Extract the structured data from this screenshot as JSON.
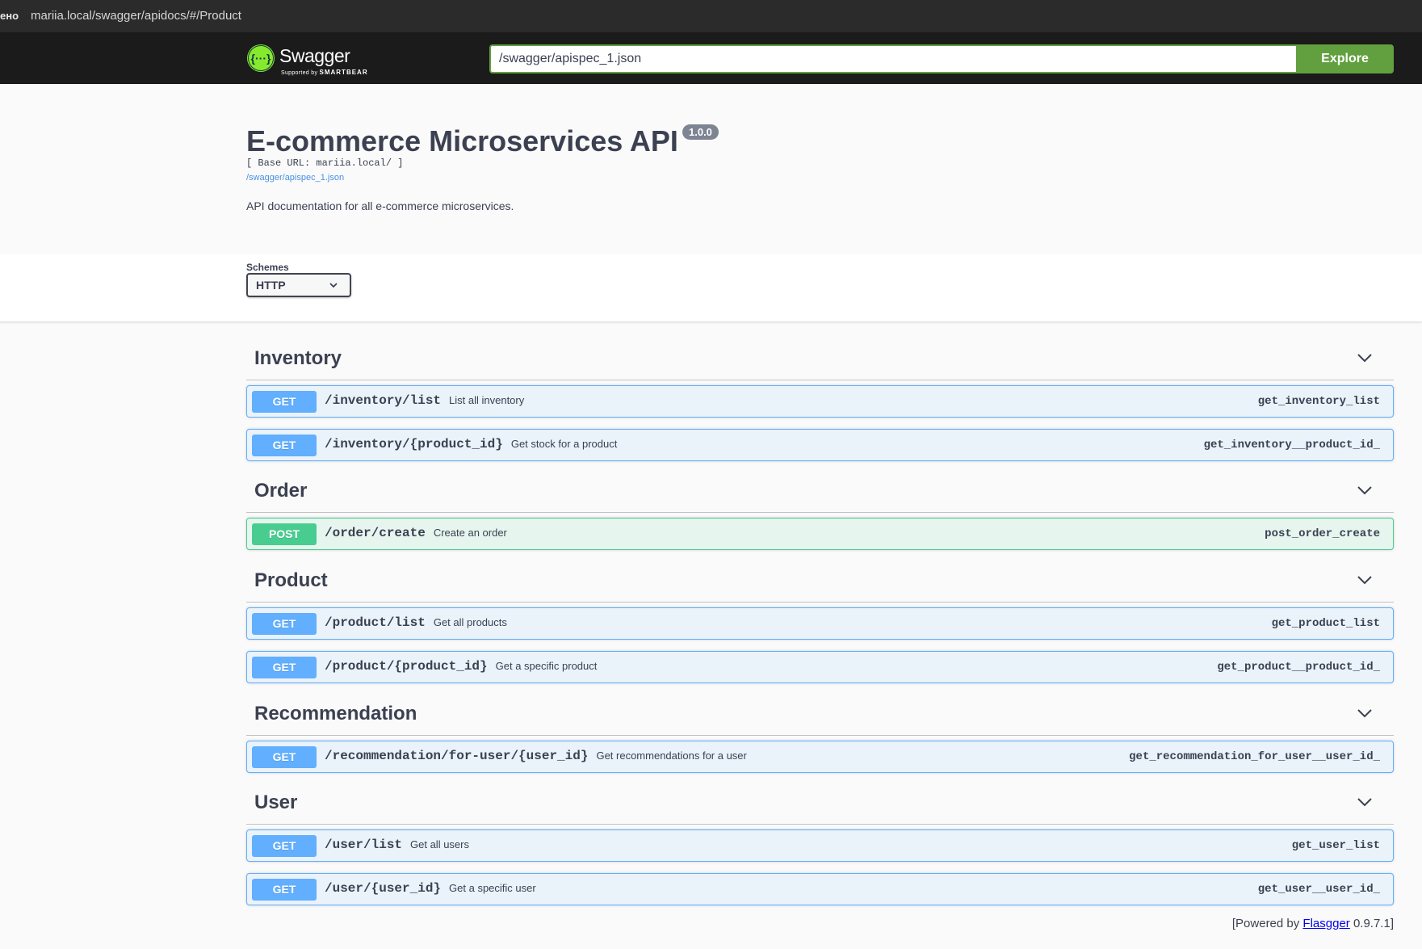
{
  "browser": {
    "security_label": "ено",
    "url": "mariia.local/swagger/apidocs/#/Product"
  },
  "topbar": {
    "logo_text": "Swagger",
    "logo_sub_prefix": "Supported by",
    "logo_sub_brand": "SMARTBEAR",
    "spec_url": "/swagger/apispec_1.json",
    "explore_label": "Explore"
  },
  "info": {
    "title": "E-commerce Microservices API",
    "version": "1.0.0",
    "base_url": "[ Base URL: mariia.local/ ]",
    "spec_link": "/swagger/apispec_1.json",
    "description": "API documentation for all e-commerce microservices."
  },
  "schemes": {
    "label": "Schemes",
    "selected": "HTTP"
  },
  "tags": [
    {
      "name": "Inventory",
      "operations": [
        {
          "method": "GET",
          "path": "/inventory/list",
          "summary": "List all inventory",
          "operation_id": "get_inventory_list"
        },
        {
          "method": "GET",
          "path": "/inventory/{product_id}",
          "summary": "Get stock for a product",
          "operation_id": "get_inventory__product_id_"
        }
      ]
    },
    {
      "name": "Order",
      "operations": [
        {
          "method": "POST",
          "path": "/order/create",
          "summary": "Create an order",
          "operation_id": "post_order_create"
        }
      ]
    },
    {
      "name": "Product",
      "operations": [
        {
          "method": "GET",
          "path": "/product/list",
          "summary": "Get all products",
          "operation_id": "get_product_list"
        },
        {
          "method": "GET",
          "path": "/product/{product_id}",
          "summary": "Get a specific product",
          "operation_id": "get_product__product_id_"
        }
      ]
    },
    {
      "name": "Recommendation",
      "operations": [
        {
          "method": "GET",
          "path": "/recommendation/for-user/{user_id}",
          "summary": "Get recommendations for a user",
          "operation_id": "get_recommendation_for_user__user_id_"
        }
      ]
    },
    {
      "name": "User",
      "operations": [
        {
          "method": "GET",
          "path": "/user/list",
          "summary": "Get all users",
          "operation_id": "get_user_list"
        },
        {
          "method": "GET",
          "path": "/user/{user_id}",
          "summary": "Get a specific user",
          "operation_id": "get_user__user_id_"
        }
      ]
    }
  ],
  "footer": {
    "prefix": "[Powered by ",
    "link": "Flasgger",
    "suffix": " 0.9.7.1]"
  },
  "colors": {
    "get": "#61affe",
    "post": "#49cc90",
    "explore": "#62a03f",
    "topbar": "#1b1b1b"
  }
}
